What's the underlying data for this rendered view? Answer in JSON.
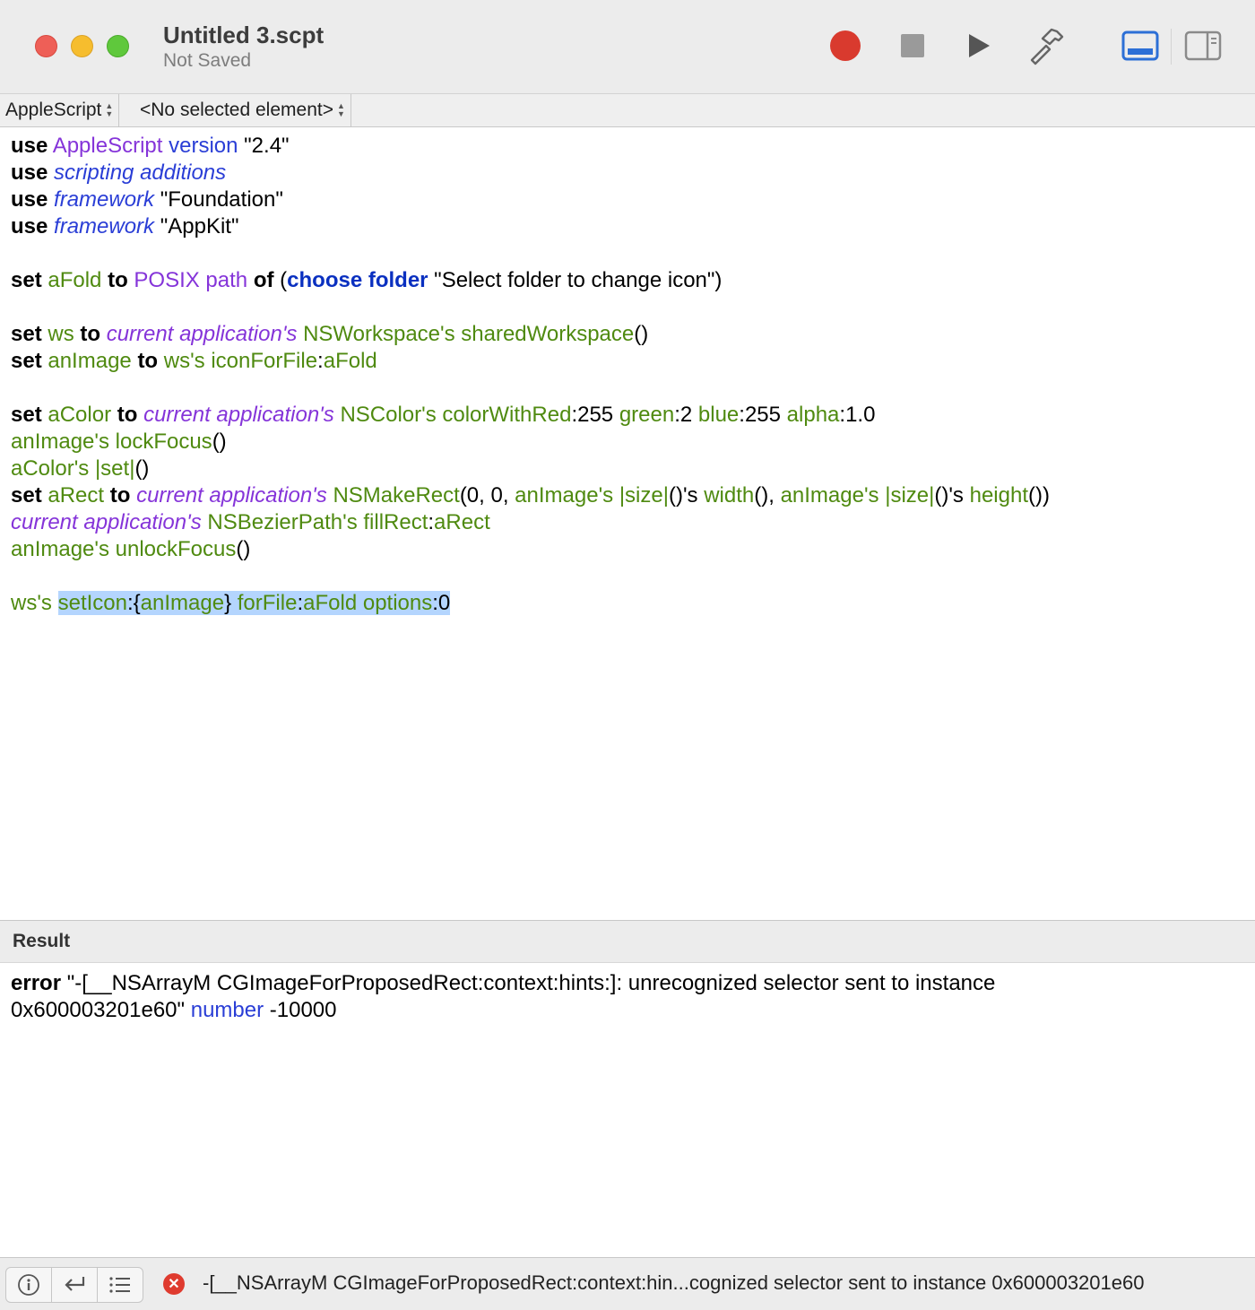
{
  "window": {
    "title": "Untitled 3.scpt",
    "subtitle": "Not Saved"
  },
  "toolbar": {
    "buttons": [
      {
        "name": "record-icon"
      },
      {
        "name": "stop-icon"
      },
      {
        "name": "run-icon"
      },
      {
        "name": "compile-hammer-icon"
      },
      {
        "name": "show-log-icon",
        "state": "active"
      },
      {
        "name": "show-inspector-icon"
      }
    ],
    "accent_color": "#2c6fd6",
    "record_color": "#d93a2e"
  },
  "navbar": {
    "language": "AppleScript",
    "element": "<No selected element>"
  },
  "editor": {
    "lines": [
      [
        {
          "c": "kw",
          "t": "use"
        },
        {
          "c": "",
          "t": " "
        },
        {
          "c": "cls",
          "t": "AppleScript"
        },
        {
          "c": "",
          "t": " "
        },
        {
          "c": "prop",
          "t": "version"
        },
        {
          "c": "",
          "t": " \"2.4\""
        }
      ],
      [
        {
          "c": "kw",
          "t": "use"
        },
        {
          "c": "",
          "t": " "
        },
        {
          "c": "it",
          "t": "scripting additions"
        }
      ],
      [
        {
          "c": "kw",
          "t": "use"
        },
        {
          "c": "",
          "t": " "
        },
        {
          "c": "it",
          "t": "framework"
        },
        {
          "c": "",
          "t": " \"Foundation\""
        }
      ],
      [
        {
          "c": "kw",
          "t": "use"
        },
        {
          "c": "",
          "t": " "
        },
        {
          "c": "it",
          "t": "framework"
        },
        {
          "c": "",
          "t": " \"AppKit\""
        }
      ],
      [],
      [
        {
          "c": "kw",
          "t": "set"
        },
        {
          "c": "",
          "t": " "
        },
        {
          "c": "var",
          "t": "aFold"
        },
        {
          "c": "",
          "t": " "
        },
        {
          "c": "kw",
          "t": "to"
        },
        {
          "c": "",
          "t": " "
        },
        {
          "c": "cls",
          "t": "POSIX path"
        },
        {
          "c": "",
          "t": " "
        },
        {
          "c": "kw",
          "t": "of"
        },
        {
          "c": "",
          "t": " ("
        },
        {
          "c": "kwb",
          "t": "choose folder"
        },
        {
          "c": "",
          "t": " \"Select folder to change icon\")"
        }
      ],
      [],
      [
        {
          "c": "kw",
          "t": "set"
        },
        {
          "c": "",
          "t": " "
        },
        {
          "c": "var",
          "t": "ws"
        },
        {
          "c": "",
          "t": " "
        },
        {
          "c": "kw",
          "t": "to"
        },
        {
          "c": "",
          "t": " "
        },
        {
          "c": "itp",
          "t": "current application's"
        },
        {
          "c": "",
          "t": " "
        },
        {
          "c": "var",
          "t": "NSWorkspace's sharedWorkspace"
        },
        {
          "c": "",
          "t": "()"
        }
      ],
      [
        {
          "c": "kw",
          "t": "set"
        },
        {
          "c": "",
          "t": " "
        },
        {
          "c": "var",
          "t": "anImage"
        },
        {
          "c": "",
          "t": " "
        },
        {
          "c": "kw",
          "t": "to"
        },
        {
          "c": "",
          "t": " "
        },
        {
          "c": "var",
          "t": "ws's iconForFile"
        },
        {
          "c": "",
          "t": ":"
        },
        {
          "c": "var",
          "t": "aFold"
        }
      ],
      [],
      [
        {
          "c": "kw",
          "t": "set"
        },
        {
          "c": "",
          "t": " "
        },
        {
          "c": "var",
          "t": "aColor"
        },
        {
          "c": "",
          "t": " "
        },
        {
          "c": "kw",
          "t": "to"
        },
        {
          "c": "",
          "t": " "
        },
        {
          "c": "itp",
          "t": "current application's"
        },
        {
          "c": "",
          "t": " "
        },
        {
          "c": "var",
          "t": "NSColor's colorWithRed"
        },
        {
          "c": "",
          "t": ":255 "
        },
        {
          "c": "var",
          "t": "green"
        },
        {
          "c": "",
          "t": ":2 "
        },
        {
          "c": "var",
          "t": "blue"
        },
        {
          "c": "",
          "t": ":255 "
        },
        {
          "c": "var",
          "t": "alpha"
        },
        {
          "c": "",
          "t": ":1.0"
        }
      ],
      [
        {
          "c": "var",
          "t": "anImage's lockFocus"
        },
        {
          "c": "",
          "t": "()"
        }
      ],
      [
        {
          "c": "var",
          "t": "aColor's |set|"
        },
        {
          "c": "",
          "t": "()"
        }
      ],
      [
        {
          "c": "kw",
          "t": "set"
        },
        {
          "c": "",
          "t": " "
        },
        {
          "c": "var",
          "t": "aRect"
        },
        {
          "c": "",
          "t": " "
        },
        {
          "c": "kw",
          "t": "to"
        },
        {
          "c": "",
          "t": " "
        },
        {
          "c": "itp",
          "t": "current application's"
        },
        {
          "c": "",
          "t": " "
        },
        {
          "c": "var",
          "t": "NSMakeRect"
        },
        {
          "c": "",
          "t": "(0, 0, "
        },
        {
          "c": "var",
          "t": "anImage's |size|"
        },
        {
          "c": "",
          "t": "()'s "
        },
        {
          "c": "var",
          "t": "width"
        },
        {
          "c": "",
          "t": "(), "
        },
        {
          "c": "var",
          "t": "anImage's |size|"
        },
        {
          "c": "",
          "t": "()'s "
        },
        {
          "c": "var",
          "t": "height"
        },
        {
          "c": "",
          "t": "())"
        }
      ],
      [
        {
          "c": "itp",
          "t": "current application's"
        },
        {
          "c": "",
          "t": " "
        },
        {
          "c": "var",
          "t": "NSBezierPath's fillRect"
        },
        {
          "c": "",
          "t": ":"
        },
        {
          "c": "var",
          "t": "aRect"
        }
      ],
      [
        {
          "c": "var",
          "t": "anImage's unlockFocus"
        },
        {
          "c": "",
          "t": "()"
        }
      ],
      [],
      [
        {
          "c": "var",
          "t": "ws's"
        },
        {
          "c": "",
          "t": " "
        },
        {
          "c": "var hl",
          "t": "setIcon"
        },
        {
          "c": "hl",
          "t": ":{"
        },
        {
          "c": "var hl",
          "t": "anImage"
        },
        {
          "c": "hl",
          "t": "} "
        },
        {
          "c": "var hl",
          "t": "forFile"
        },
        {
          "c": "hl",
          "t": ":"
        },
        {
          "c": "var hl",
          "t": "aFold"
        },
        {
          "c": "hl",
          "t": " "
        },
        {
          "c": "var hl",
          "t": "options"
        },
        {
          "c": "hl",
          "t": ":0"
        }
      ]
    ]
  },
  "result": {
    "header": "Result",
    "error_keyword": "error",
    "message_line1": " \"-[__NSArrayM CGImageForProposedRect:context:hints:]: unrecognized selector sent to instance",
    "message_line2": "0x600003201e60\"",
    "number_keyword": "number",
    "number_value": " -10000"
  },
  "statusbar": {
    "buttons": [
      {
        "name": "info-icon"
      },
      {
        "name": "reply-arrow-icon"
      },
      {
        "name": "list-icon"
      }
    ],
    "error_text": "-[__NSArrayM CGImageForProposedRect:context:hin...cognized selector sent to instance 0x600003201e60"
  }
}
